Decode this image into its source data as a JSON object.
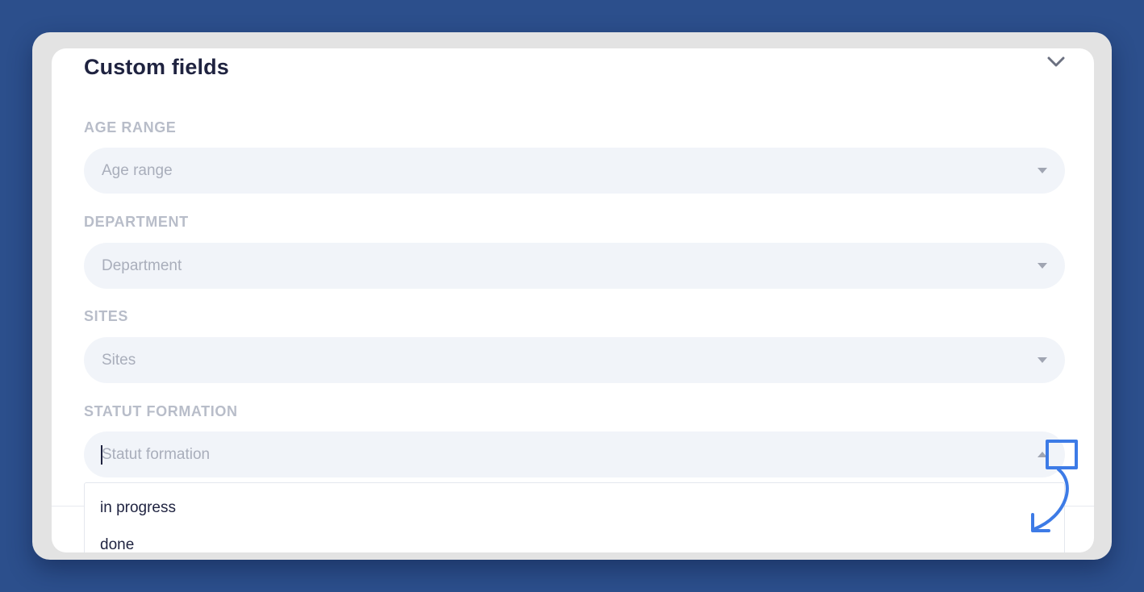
{
  "section": {
    "title": "Custom fields",
    "collapse_icon": "chevron-down-icon"
  },
  "fields": [
    {
      "label": "AGE RANGE",
      "placeholder": "Age range"
    },
    {
      "label": "DEPARTMENT",
      "placeholder": "Department"
    },
    {
      "label": "SITES",
      "placeholder": "Sites"
    },
    {
      "label": "STATUT FORMATION",
      "placeholder": "Statut formation"
    }
  ],
  "dropdown": {
    "options": [
      "in progress",
      "done"
    ]
  },
  "colors": {
    "background": "#2c4f8c",
    "accent": "#3d7be6",
    "title": "#1f2340",
    "label": "#b8bdc9",
    "field_bg": "#f1f4f9"
  }
}
